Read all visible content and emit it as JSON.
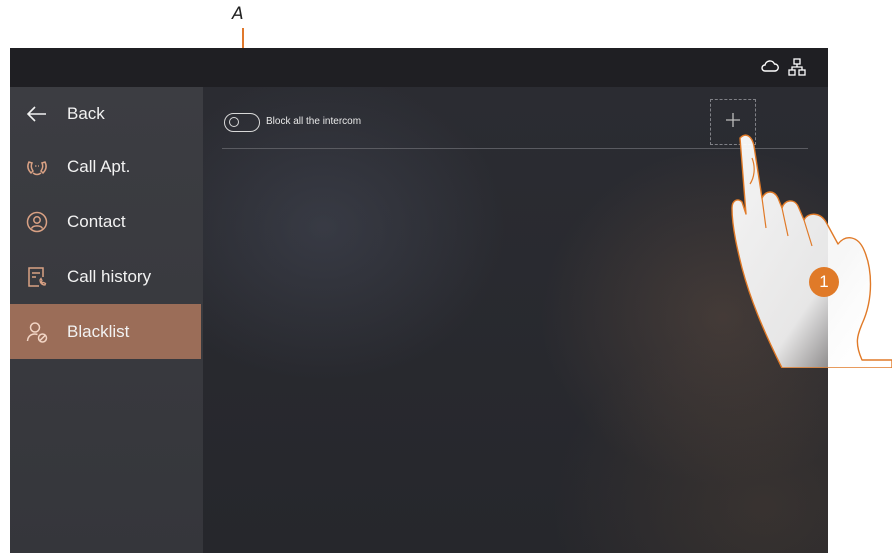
{
  "annotation": {
    "letter": "A",
    "step_number": "1"
  },
  "status_bar": {
    "icons": [
      "cloud-icon",
      "network-icon"
    ]
  },
  "sidebar": {
    "items": [
      {
        "label": "Back",
        "icon": "arrow-left-icon",
        "active": false
      },
      {
        "label": "Call Apt.",
        "icon": "intercom-call-icon",
        "active": false
      },
      {
        "label": "Contact",
        "icon": "contact-icon",
        "active": false
      },
      {
        "label": "Call history",
        "icon": "call-history-icon",
        "active": false
      },
      {
        "label": "Blacklist",
        "icon": "blacklist-icon",
        "active": true
      }
    ]
  },
  "main": {
    "toggle_label": "Block all the intercom",
    "toggle_on": false,
    "add_button_icon": "plus-icon"
  },
  "colors": {
    "accent": "#e07a28",
    "active_item": "#9b6d58",
    "sidebar": "#3a3b40",
    "status_bar": "#1f1f23"
  }
}
